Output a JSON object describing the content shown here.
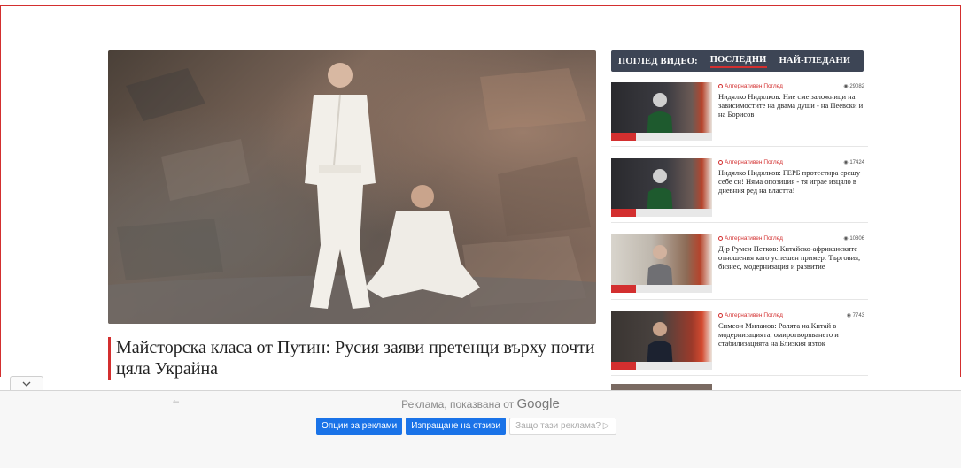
{
  "hero": {
    "headline": "Майсторска класа от Путин: Русия заяви претенци върху почти цяла Украйна",
    "accent_color": "#d32f2f"
  },
  "sidebar": {
    "label": "ПОГЛЕД ВИДЕО:",
    "tabs": [
      "ПОСЛЕДНИ",
      "НАЙ-ГЛЕДАНИ"
    ],
    "active_tab": "ПОСЛЕДНИ",
    "header_bg": "#3d4555",
    "videos": [
      {
        "category": "Алтернативен Поглед",
        "views": "29082",
        "title": "Нидялко Нидялков: Ние сме заложници на зависимостите на двама души - на Пеевски и на Борисов"
      },
      {
        "category": "Алтернативен Поглед",
        "views": "17424",
        "title": "Нидялко Нидялков: ГЕРБ протестира срещу себе си! Няма опозиция - тя играе изцяло в дневния ред на властта!"
      },
      {
        "category": "Алтернативен Поглед",
        "views": "10806",
        "title": "Д-р Румен Петков: Китайско-африканските отношения като успешен пример: Търговия, бизнес, модернизация и развитие"
      },
      {
        "category": "Алтернативен Поглед",
        "views": "7743",
        "title": "Симеон Миланов: Ролята на Китай в модернизацията, омиротворяването и стабилизацията на Близкия изток"
      }
    ]
  },
  "ad": {
    "collapse_icon": "chevron-down-icon",
    "back_icon": "arrow-left-icon",
    "shown_by": "Реклама, показвана от",
    "google": "Google",
    "buttons": {
      "options": "Опции за реклами",
      "feedback": "Изпращане на отзиви",
      "why": "Защо тази реклама? ▷"
    },
    "button_color": "#1a73e8"
  }
}
